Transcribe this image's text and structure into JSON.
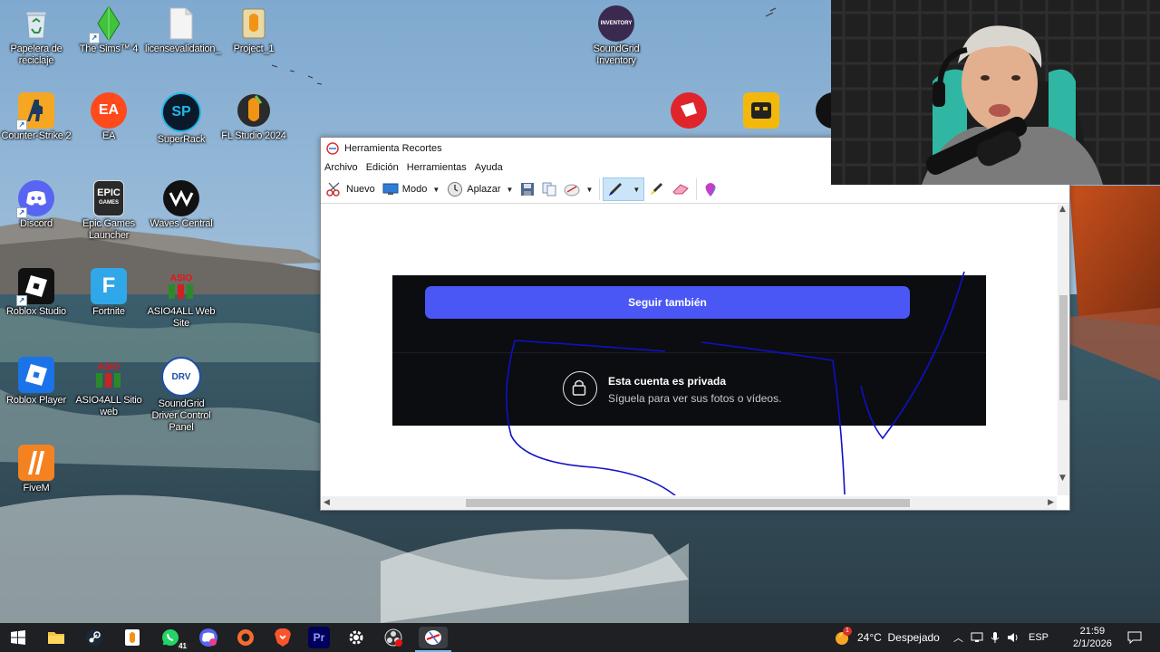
{
  "desktop": {
    "icons": [
      {
        "label": "Papelera de reciclaje",
        "icon": "recycle-bin-icon"
      },
      {
        "label": "The Sims™ 4",
        "icon": "sims-icon"
      },
      {
        "label": "licensevalidation_",
        "icon": "file-icon"
      },
      {
        "label": "Project_1",
        "icon": "fl-project-icon"
      },
      {
        "label": "Counter-Strike 2",
        "icon": "cs2-icon"
      },
      {
        "label": "EA",
        "icon": "ea-icon"
      },
      {
        "label": "SuperRack",
        "icon": "superrack-icon"
      },
      {
        "label": "FL Studio 2024",
        "icon": "fl-studio-icon"
      },
      {
        "label": "Discord",
        "icon": "discord-icon"
      },
      {
        "label": "Epic Games Launcher",
        "icon": "epic-games-icon"
      },
      {
        "label": "Waves Central",
        "icon": "waves-icon"
      },
      {
        "label": "Roblox Studio",
        "icon": "roblox-studio-icon"
      },
      {
        "label": "Fortnite",
        "icon": "fortnite-icon"
      },
      {
        "label": "ASIO4ALL Web Site",
        "icon": "asio-icon"
      },
      {
        "label": "Roblox Player",
        "icon": "roblox-player-icon"
      },
      {
        "label": "ASIO4ALL Sitio web",
        "icon": "asio-icon"
      },
      {
        "label": "SoundGrid Driver Control Panel",
        "icon": "soundgrid-driver-icon"
      },
      {
        "label": "FiveM",
        "icon": "fivem-icon"
      },
      {
        "label": "SoundGrid Inventory",
        "icon": "soundgrid-inventory-icon"
      }
    ],
    "logo_text": {
      "epic": "EPIC",
      "epic_sub": "GAMES",
      "ea": "EA",
      "sp": "SP",
      "f": "F",
      "asio": "ASIO",
      "drv": "DRV",
      "inventory": "INVENTORY"
    }
  },
  "snipping_tool": {
    "title": "Herramienta Recortes",
    "menu": [
      "Archivo",
      "Edición",
      "Herramientas",
      "Ayuda"
    ],
    "toolbar": {
      "new": "Nuevo",
      "mode": "Modo",
      "delay": "Aplazar"
    },
    "capture": {
      "follow_button": "Seguir también",
      "private_title": "Esta cuenta es privada",
      "private_subtitle": "Síguela para ver sus fotos o vídeos.",
      "bg": "#0c0d11",
      "button_color": "#4a57f5"
    },
    "pen_color": "#1010c8"
  },
  "taskbar": {
    "apps": [
      "start-icon",
      "file-explorer-icon",
      "steam-icon",
      "fl-studio-icon",
      "whatsapp-icon",
      "discord-icon",
      "origin-icon",
      "brave-icon",
      "premiere-icon",
      "settings-icon",
      "obs-icon",
      "snipping-tool-icon"
    ],
    "premiere_text": "Pr",
    "whatsapp_badge": "41",
    "weather_badge": "1",
    "weather": "24°C  Despejado",
    "language": "ESP",
    "time": "21:59",
    "date": "2/1/2026"
  }
}
